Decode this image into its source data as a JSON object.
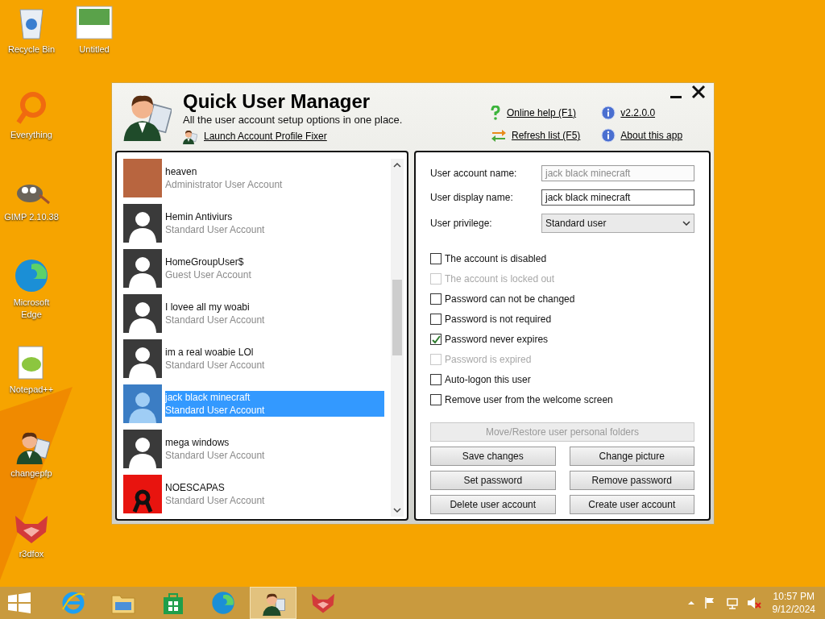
{
  "desktop_icons": [
    {
      "label": "Recycle Bin",
      "kind": "recycle"
    },
    {
      "label": "Untitled",
      "kind": "image"
    },
    {
      "label": "Everything",
      "kind": "everything"
    },
    {
      "label": "GIMP 2.10.38",
      "kind": "gimp"
    },
    {
      "label": "Microsoft Edge",
      "kind": "edge"
    },
    {
      "label": "Notepad++",
      "kind": "notepad"
    },
    {
      "label": "changepfp",
      "kind": "user"
    },
    {
      "label": "r3dfox",
      "kind": "fox"
    }
  ],
  "window": {
    "title": "Quick User Manager",
    "subtitle": "All the user account setup options in one place.",
    "fixer_link": "Launch Account Profile Fixer",
    "online_help": "Online help (F1)",
    "refresh": "Refresh list (F5)",
    "version": "v2.2.0.0",
    "about": "About this app"
  },
  "users": [
    {
      "name": "heaven",
      "type": "Administrator User Account",
      "kind": "photo",
      "selected": false
    },
    {
      "name": "Hemin Antiviurs",
      "type": "Standard User Account",
      "kind": "default",
      "selected": false
    },
    {
      "name": "HomeGroupUser$",
      "type": "Guest User Account",
      "kind": "default",
      "selected": false
    },
    {
      "name": "I lovee all my woabi",
      "type": "Standard User Account",
      "kind": "default",
      "selected": false
    },
    {
      "name": "im a real woabie LOl",
      "type": "Standard User Account",
      "kind": "default",
      "selected": false
    },
    {
      "name": "jack black minecraft",
      "type": "Standard User Account",
      "kind": "default",
      "selected": true
    },
    {
      "name": "mega windows",
      "type": "Standard User Account",
      "kind": "default",
      "selected": false
    },
    {
      "name": "NOESCAPAS",
      "type": "Standard User Account",
      "kind": "symbol",
      "selected": false
    }
  ],
  "form": {
    "fields": [
      {
        "label": "User account name:",
        "value": "jack black minecraft",
        "kind": "text",
        "disabled": true
      },
      {
        "label": "User display name:",
        "value": "jack black minecraft",
        "kind": "text",
        "disabled": false
      },
      {
        "label": "User privilege:",
        "value": "Standard user",
        "kind": "select"
      }
    ],
    "checkboxes": [
      {
        "label": "The account is disabled",
        "checked": false,
        "disabled": false
      },
      {
        "label": "The account is locked out",
        "checked": false,
        "disabled": true
      },
      {
        "label": "Password can not be changed",
        "checked": false,
        "disabled": false
      },
      {
        "label": "Password is not required",
        "checked": false,
        "disabled": false
      },
      {
        "label": "Password never expires",
        "checked": true,
        "disabled": false
      },
      {
        "label": "Password is expired",
        "checked": false,
        "disabled": true
      },
      {
        "label": "Auto-logon this user",
        "checked": false,
        "disabled": false
      },
      {
        "label": "Remove user from the welcome screen",
        "checked": false,
        "disabled": false
      }
    ],
    "wide_button": {
      "label": "Move/Restore user personal folders",
      "disabled": true
    },
    "buttons": [
      {
        "label": "Save changes",
        "disabled": false
      },
      {
        "label": "Change picture",
        "disabled": false
      },
      {
        "label": "Set password",
        "disabled": false
      },
      {
        "label": "Remove password",
        "disabled": false
      },
      {
        "label": "Delete user account",
        "disabled": false
      },
      {
        "label": "Create user account",
        "disabled": false
      }
    ]
  },
  "taskbar": {
    "apps": [
      {
        "kind": "ie",
        "active": false
      },
      {
        "kind": "explorer",
        "active": false
      },
      {
        "kind": "store",
        "active": false
      },
      {
        "kind": "edge",
        "active": false
      },
      {
        "kind": "user",
        "active": true
      },
      {
        "kind": "fox",
        "active": false
      }
    ],
    "time": "10:57 PM",
    "date": "9/12/2024"
  }
}
